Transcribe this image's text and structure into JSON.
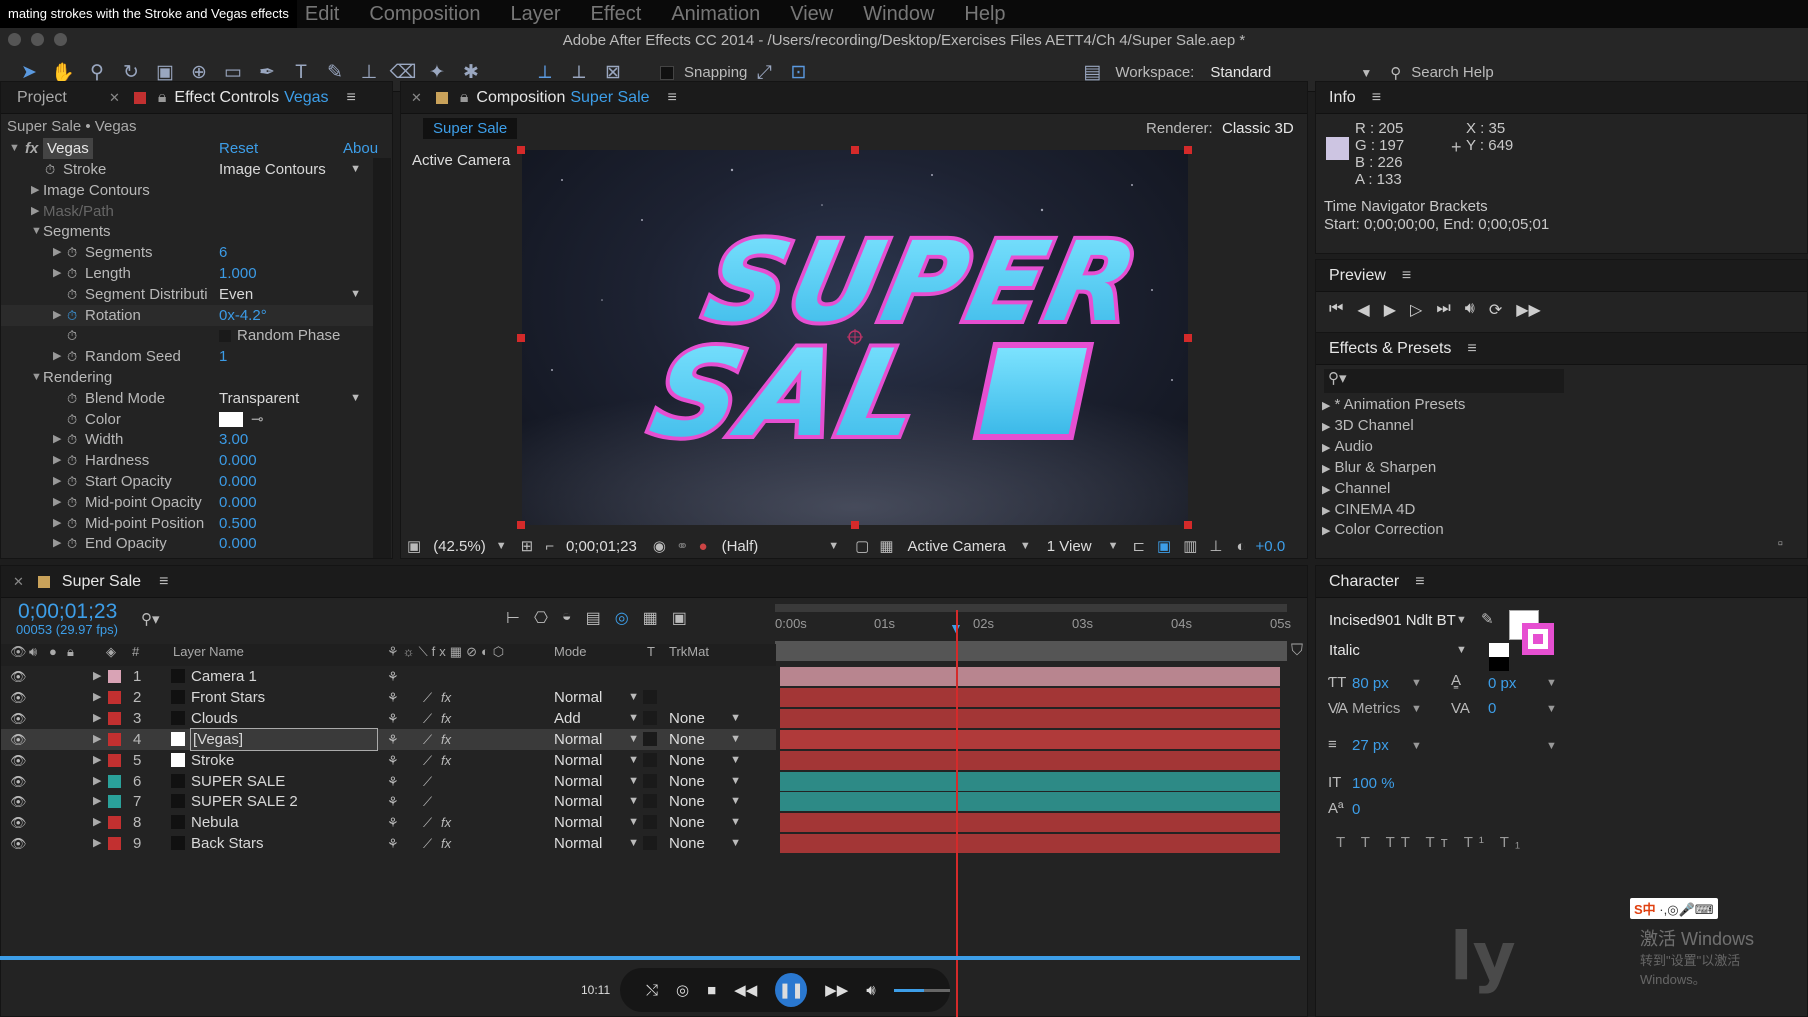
{
  "tutorial_title": "mating strokes with the Stroke and Vegas effects",
  "menu": [
    "Edit",
    "Composition",
    "Layer",
    "Effect",
    "Animation",
    "View",
    "Window",
    "Help"
  ],
  "window_title": "Adobe After Effects CC 2014 - /Users/recording/Desktop/Exercises Files AETT4/Ch 4/Super Sale.aep *",
  "toolbar": {
    "snapping": "Snapping",
    "workspace_label": "Workspace:",
    "workspace_value": "Standard",
    "search_placeholder": "Search Help"
  },
  "effect_panel": {
    "tab_project": "Project",
    "tab_effect_controls": "Effect Controls",
    "tab_effect_layer": "Vegas",
    "breadcrumb": "Super Sale • Vegas",
    "fx_badge": "fx",
    "effect_name": "Vegas",
    "reset": "Reset",
    "about": "Abou",
    "rows": [
      {
        "name": "Stroke",
        "value": "Image Contours"
      },
      {
        "name": "Image Contours"
      },
      {
        "name": "Mask/Path"
      },
      {
        "name": "Segments"
      },
      {
        "name": "Segments",
        "value": "6"
      },
      {
        "name": "Length",
        "value": "1.000"
      },
      {
        "name": "Segment Distributi",
        "value": "Even"
      },
      {
        "name": "Rotation",
        "value": "0x-4.2°"
      },
      {
        "name": "Random Phase"
      },
      {
        "name": "Random Seed",
        "value": "1"
      },
      {
        "name": "Rendering"
      },
      {
        "name": "Blend Mode",
        "value": "Transparent"
      },
      {
        "name": "Color"
      },
      {
        "name": "Width",
        "value": "3.00"
      },
      {
        "name": "Hardness",
        "value": "0.000"
      },
      {
        "name": "Start Opacity",
        "value": "0.000"
      },
      {
        "name": "Mid-point Opacity",
        "value": "0.000"
      },
      {
        "name": "Mid-point Position",
        "value": "0.500"
      },
      {
        "name": "End Opacity",
        "value": "0.000"
      }
    ]
  },
  "composition": {
    "tab_label": "Composition",
    "tab_comp": "Super Sale",
    "breadcrumb": "Super Sale",
    "renderer_label": "Renderer:",
    "renderer_value": "Classic 3D",
    "camera_label": "Active Camera",
    "artwork_line1": "SUPER",
    "artwork_line2": "SAL",
    "footer": {
      "zoom": "(42.5%)",
      "timecode": "0;00;01;23",
      "resolution": "(Half)",
      "camera": "Active Camera",
      "view": "1 View",
      "exposure": "+0.0"
    }
  },
  "info_panel": {
    "title": "Info",
    "r": "R : 205",
    "g": "G : 197",
    "b": "B : 226",
    "a": "A : 133",
    "x": "X : 35",
    "y": "Y : 649",
    "nav_title": "Time Navigator Brackets",
    "nav_range": "Start: 0;00;00;00, End: 0;00;05;01",
    "swatch_color": "#cdc5e2"
  },
  "preview_panel": {
    "title": "Preview"
  },
  "effects_presets": {
    "title": "Effects & Presets",
    "search_placeholder": "",
    "items": [
      "* Animation Presets",
      "3D Channel",
      "Audio",
      "Blur & Sharpen",
      "Channel",
      "CINEMA 4D",
      "Color Correction"
    ]
  },
  "timeline": {
    "tab": "Super Sale",
    "timecode": "0;00;01;23",
    "frames": "00053 (29.97 fps)",
    "col_num": "#",
    "col_layer": "Layer Name",
    "col_mode": "Mode",
    "col_t": "T",
    "col_trkmat": "TrkMat",
    "ruler": [
      "0:00s",
      "01s",
      "02s",
      "03s",
      "04s",
      "05s"
    ],
    "layers": [
      {
        "num": "1",
        "name": "Camera 1",
        "mode": "",
        "trkmat": "",
        "label": "#d9a3b5",
        "bar": "#b8858f"
      },
      {
        "num": "2",
        "name": "Front Stars",
        "mode": "Normal",
        "trkmat": "",
        "label": "#c23030",
        "bar": "#a33636"
      },
      {
        "num": "3",
        "name": "Clouds",
        "mode": "Add",
        "trkmat": "None",
        "label": "#c23030",
        "bar": "#a33636"
      },
      {
        "num": "4",
        "name": "[Vegas]",
        "mode": "Normal",
        "trkmat": "None",
        "label": "#c23030",
        "bar": "#b03a3a"
      },
      {
        "num": "5",
        "name": "Stroke",
        "mode": "Normal",
        "trkmat": "None",
        "label": "#c23030",
        "bar": "#a33636"
      },
      {
        "num": "6",
        "name": "SUPER SALE",
        "mode": "Normal",
        "trkmat": "None",
        "label": "#2aa19a",
        "bar": "#2d8a86"
      },
      {
        "num": "7",
        "name": "SUPER SALE 2",
        "mode": "Normal",
        "trkmat": "None",
        "label": "#2aa19a",
        "bar": "#2d8a86"
      },
      {
        "num": "8",
        "name": "Nebula",
        "mode": "Normal",
        "trkmat": "None",
        "label": "#c23030",
        "bar": "#a33636"
      },
      {
        "num": "9",
        "name": "Back Stars",
        "mode": "Normal",
        "trkmat": "None",
        "label": "#c23030",
        "bar": "#a33636"
      }
    ],
    "player_time": "10:11"
  },
  "character_panel": {
    "title": "Character",
    "font": "Incised901 Ndlt BT",
    "style": "Italic",
    "size": "80 px",
    "leading": "0 px",
    "kerning": "Metrics",
    "tracking": "0",
    "stroke_width": "27 px",
    "vscale": "100 %",
    "baseline": "0"
  },
  "watermark": {
    "windows": "激活 Windows",
    "windows_sub": "转到\"设置\"以激活 Windows。",
    "ime": "S中"
  }
}
